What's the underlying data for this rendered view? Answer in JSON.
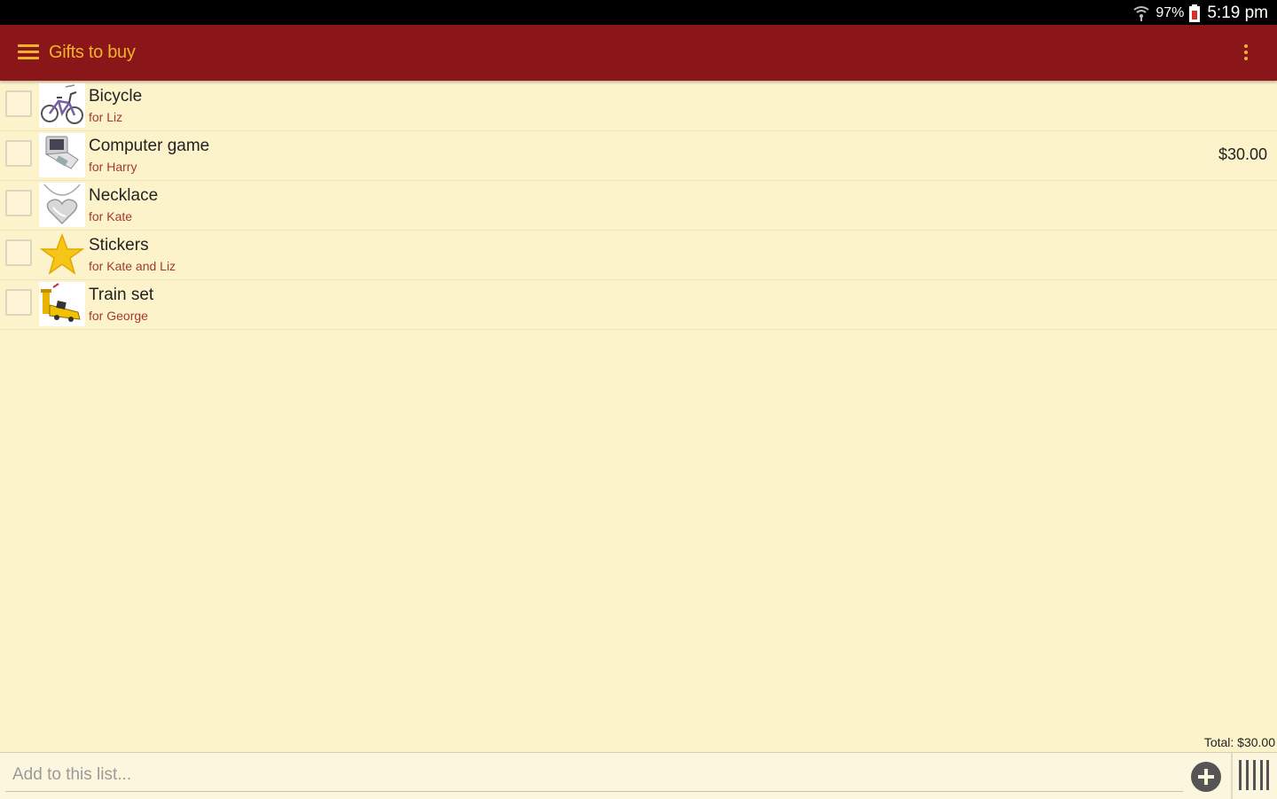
{
  "status_bar": {
    "wifi_icon": "wifi-icon",
    "battery_percent": "97%",
    "battery_icon": "battery-icon",
    "time": "5:19 pm"
  },
  "app_bar": {
    "title": "Gifts to buy",
    "menu_icon": "menu-icon",
    "overflow_icon": "overflow-menu-icon",
    "color": "#8b1619",
    "accent": "#f0b429"
  },
  "items": [
    {
      "name": "Bicycle",
      "for": "for Liz",
      "icon": "bicycle-icon",
      "checked": false
    },
    {
      "name": "Computer game",
      "for": "for Harry",
      "icon": "handheld-console-icon",
      "checked": false,
      "price": "$30.00"
    },
    {
      "name": "Necklace",
      "for": "for Kate",
      "icon": "heart-necklace-icon",
      "checked": false
    },
    {
      "name": "Stickers",
      "for": "for Kate and Liz",
      "icon": "star-icon",
      "checked": false
    },
    {
      "name": "Train set",
      "for": "for George",
      "icon": "toy-train-icon",
      "checked": false
    }
  ],
  "total": "Total: $30.00",
  "input": {
    "placeholder": "Add to this list...",
    "add_icon": "add-circle-icon",
    "barcode_icon": "barcode-icon"
  },
  "colors": {
    "background": "#fdf3cb",
    "for_text": "#a23b2a"
  }
}
